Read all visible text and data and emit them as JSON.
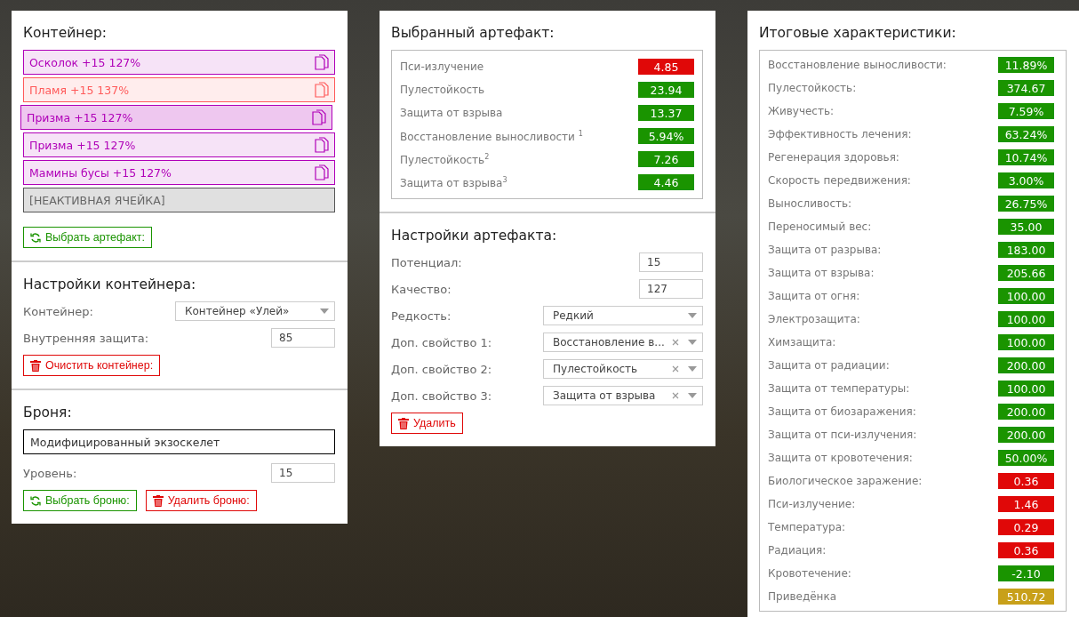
{
  "container": {
    "title": "Контейнер:",
    "slots": [
      {
        "kind": "artifact",
        "label": "Осколок +15 127%",
        "color": "#b000b8",
        "selected": false
      },
      {
        "kind": "artifact",
        "label": "Пламя +15 137%",
        "color": "#ff5a5a",
        "selected": false
      },
      {
        "kind": "artifact",
        "label": "Призма +15 127%",
        "color": "#b000b8",
        "selected": true
      },
      {
        "kind": "artifact",
        "label": "Призма +15 127%",
        "color": "#b000b8",
        "selected": false
      },
      {
        "kind": "artifact",
        "label": "Мамины бусы +15 127%",
        "color": "#b000b8",
        "selected": false
      },
      {
        "kind": "inactive",
        "label": "[НЕАКТИВНАЯ ЯЧЕЙКА]"
      }
    ],
    "button": {
      "kind": "select",
      "label": "Выбрать артефакт:"
    }
  },
  "container_settings": {
    "title": "Настройки контейнера:",
    "fields": [
      {
        "kind": "select",
        "label": "Контейнер:",
        "value": "Контейнер «Улей»",
        "clearable": false
      },
      {
        "kind": "input",
        "label": "Внутренняя защита:",
        "value": "85"
      }
    ],
    "button": {
      "kind": "delete",
      "label": "Очистить контейнер:"
    }
  },
  "armor": {
    "title": "Броня:",
    "name": "Модифицированный экзоскелет",
    "fields": [
      {
        "kind": "input",
        "label": "Уровень:",
        "value": "15"
      }
    ],
    "buttons": [
      {
        "kind": "select",
        "label": "Выбрать броню:"
      },
      {
        "kind": "delete",
        "label": "Удалить броню:"
      }
    ]
  },
  "selected_artifact": {
    "title": "Выбранный артефакт:",
    "stats": [
      {
        "name": "Пси-излучение",
        "value": "4.85",
        "color": "#e00808"
      },
      {
        "name": "Пулестойкость",
        "value": "23.94",
        "color": "#1a9400"
      },
      {
        "name": "Защита от взрыва",
        "value": "13.37",
        "color": "#1a9400"
      },
      {
        "name": "Восстановление выносливости $^{1}$",
        "value": "5.94%",
        "color": "#1a9400"
      },
      {
        "name": "Пулестойкость$^{2}$",
        "value": "7.26",
        "color": "#1a9400"
      },
      {
        "name": "Защита от взрыва$^{3}$",
        "value": "4.46",
        "color": "#1a9400"
      }
    ]
  },
  "artifact_settings": {
    "title": "Настройки артефакта:",
    "fields": [
      {
        "kind": "input",
        "label": "Потенциал:",
        "value": "15"
      },
      {
        "kind": "input",
        "label": "Качество:",
        "value": "127"
      },
      {
        "kind": "select",
        "label": "Редкость:",
        "value": "Редкий",
        "clearable": false
      },
      {
        "kind": "select",
        "label": "Доп. свойство 1:",
        "value": "Восстановление в...",
        "clearable": true
      },
      {
        "kind": "select",
        "label": "Доп. свойство 2:",
        "value": "Пулестойкость",
        "clearable": true
      },
      {
        "kind": "select",
        "label": "Доп. свойство 3:",
        "value": "Защита от взрыва",
        "clearable": true
      }
    ],
    "button": {
      "kind": "delete",
      "label": "Удалить"
    }
  },
  "totals": {
    "title": "Итоговые характеристики:",
    "stats": [
      {
        "name": "Восстановление выносливости:",
        "value": "11.89%",
        "color": "#1a9400"
      },
      {
        "name": "Пулестойкость:",
        "value": "374.67",
        "color": "#1a9400"
      },
      {
        "name": "Живучесть:",
        "value": "7.59%",
        "color": "#1a9400"
      },
      {
        "name": "Эффективность лечения:",
        "value": "63.24%",
        "color": "#1a9400"
      },
      {
        "name": "Регенерация здоровья:",
        "value": "10.74%",
        "color": "#1a9400"
      },
      {
        "name": "Скорость передвижения:",
        "value": "3.00%",
        "color": "#1a9400"
      },
      {
        "name": "Выносливость:",
        "value": "26.75%",
        "color": "#1a9400"
      },
      {
        "name": "Переносимый вес:",
        "value": "35.00",
        "color": "#1a9400"
      },
      {
        "name": "Защита от разрыва:",
        "value": "183.00",
        "color": "#1a9400"
      },
      {
        "name": "Защита от взрыва:",
        "value": "205.66",
        "color": "#1a9400"
      },
      {
        "name": "Защита от огня:",
        "value": "100.00",
        "color": "#1a9400"
      },
      {
        "name": "Электрозащита:",
        "value": "100.00",
        "color": "#1a9400"
      },
      {
        "name": "Химзащита:",
        "value": "100.00",
        "color": "#1a9400"
      },
      {
        "name": "Защита от радиации:",
        "value": "200.00",
        "color": "#1a9400"
      },
      {
        "name": "Защита от температуры:",
        "value": "100.00",
        "color": "#1a9400"
      },
      {
        "name": "Защита от биозаражения:",
        "value": "200.00",
        "color": "#1a9400"
      },
      {
        "name": "Защита от пси-излучения:",
        "value": "200.00",
        "color": "#1a9400"
      },
      {
        "name": "Защита от кровотечения:",
        "value": "50.00%",
        "color": "#1a9400"
      },
      {
        "name": "Биологическое заражение:",
        "value": "0.36",
        "color": "#e00808"
      },
      {
        "name": "Пси-излучение:",
        "value": "1.46",
        "color": "#e00808"
      },
      {
        "name": "Температура:",
        "value": "0.29",
        "color": "#e00808"
      },
      {
        "name": "Радиация:",
        "value": "0.36",
        "color": "#e00808"
      },
      {
        "name": "Кровотечение:",
        "value": "-2.10",
        "color": "#1a9400"
      },
      {
        "name": "Приведёнка",
        "value": "510.72",
        "color": "#c8a01a"
      }
    ]
  }
}
